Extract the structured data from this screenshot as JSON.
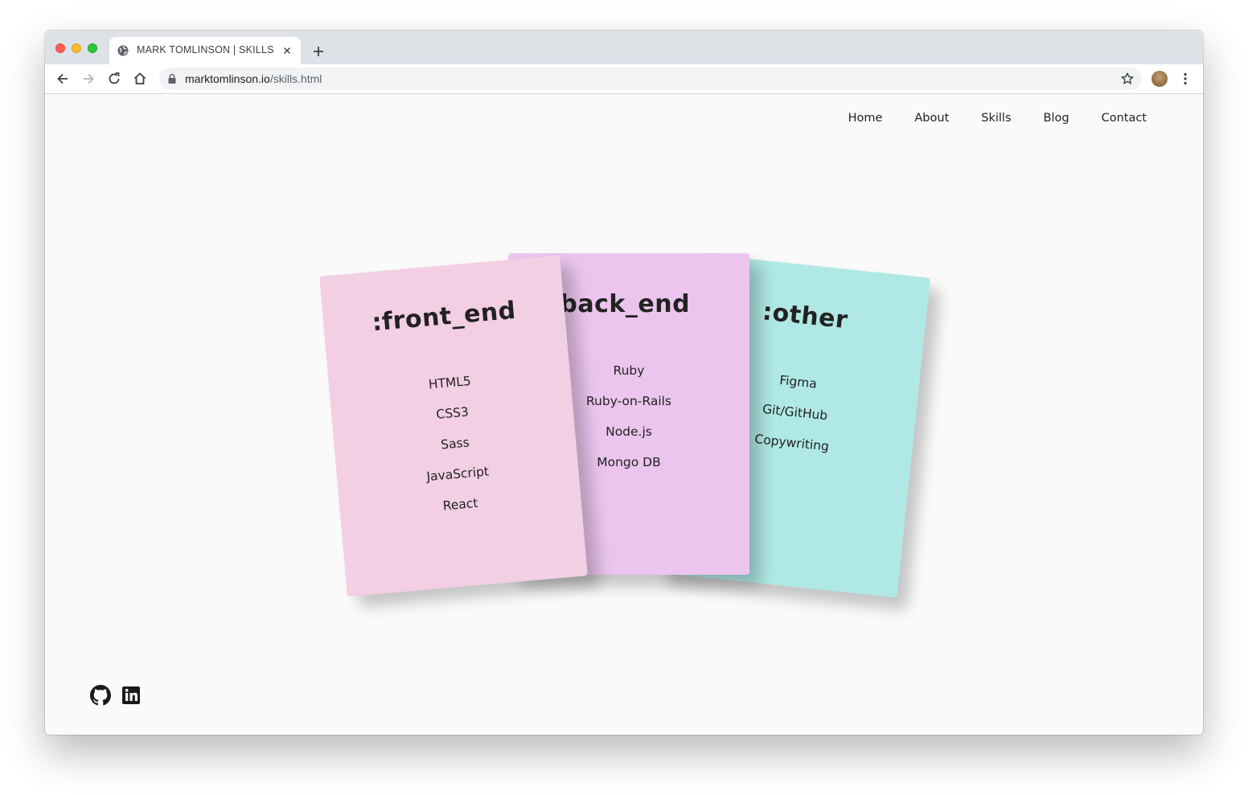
{
  "browser": {
    "tab_title": "MARK TOMLINSON | SKILLS",
    "url_domain": "marktomlinson.io",
    "url_path": "/skills.html"
  },
  "nav": {
    "items": [
      {
        "label": "Home"
      },
      {
        "label": "About"
      },
      {
        "label": "Skills"
      },
      {
        "label": "Blog"
      },
      {
        "label": "Contact"
      }
    ]
  },
  "cards": {
    "front_end": {
      "title": ":front_end",
      "color": "#f2cfe3",
      "items": [
        "HTML5",
        "CSS3",
        "Sass",
        "JavaScript",
        "React"
      ]
    },
    "back_end": {
      "title": ":back_end",
      "color": "#ebc5ee",
      "items": [
        "Ruby",
        "Ruby-on-Rails",
        "Node.js",
        "Mongo DB"
      ]
    },
    "other": {
      "title": ":other",
      "color": "#b0e8e5",
      "items": [
        "Figma",
        "Git/GitHub",
        "Copywriting"
      ]
    }
  },
  "social": {
    "icons": [
      "github-icon",
      "linkedin-icon"
    ]
  }
}
